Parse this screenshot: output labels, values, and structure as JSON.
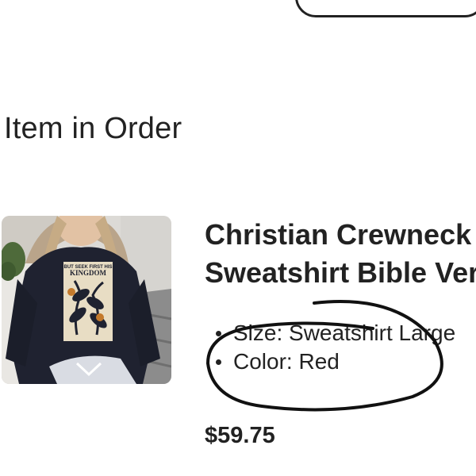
{
  "order_section": {
    "title": "Item in Order"
  },
  "item": {
    "image_icon": "product-photo-sweatshirt",
    "shirt_print": {
      "line1": "BUT SEEK FIRST HIS",
      "line2": "KINGDOM"
    },
    "title_line1": "Christian Crewneck",
    "title_line2": "Sweatshirt Bible Verse",
    "variations": [
      {
        "label": "Size: Sweatshirt Large"
      },
      {
        "label": "Color: Red"
      }
    ],
    "price": "$59.75"
  },
  "colors": {
    "text": "#222222",
    "background": "#ffffff",
    "sweatshirt": "#1f2230",
    "print_panel": "#e8ddc4",
    "print_accent": "#c47a2c"
  }
}
